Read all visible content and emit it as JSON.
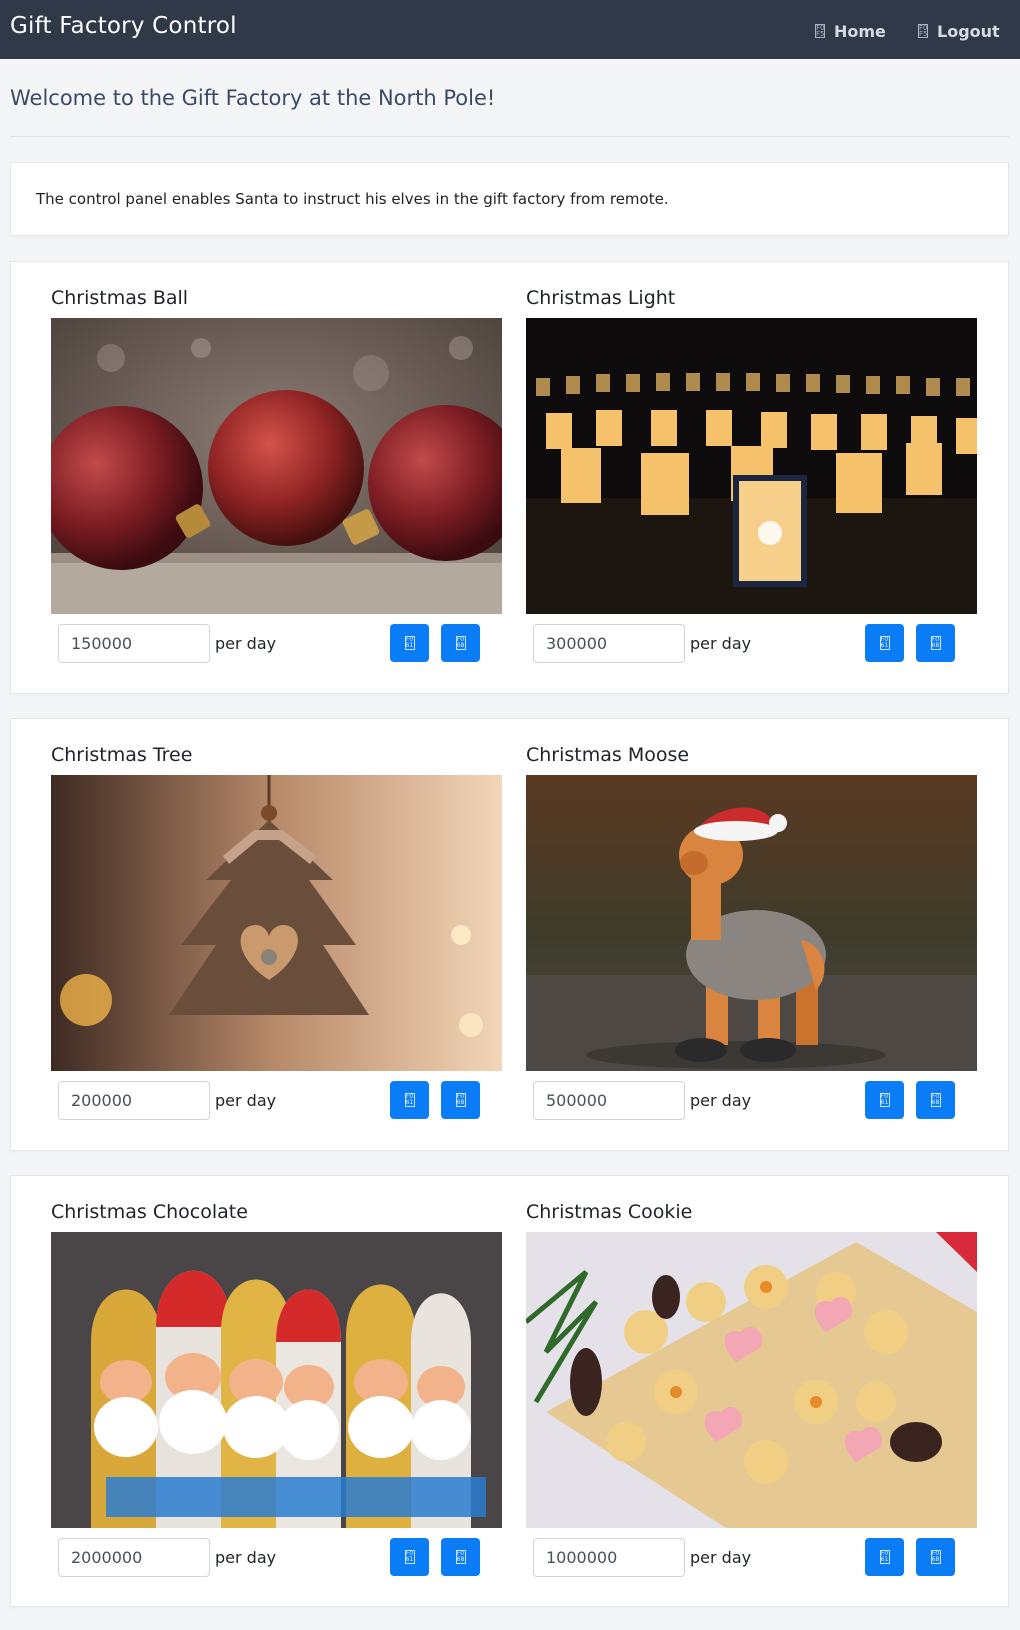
{
  "app": {
    "brand": "Gift Factory Control",
    "nav": {
      "home_label": "Home",
      "logout_label": "Logout",
      "home_icon_glyph": "F0\nF5",
      "logout_icon_glyph": "F0\nF5"
    }
  },
  "page": {
    "welcome": "Welcome to the Gift Factory at the North Pole!",
    "intro": "The control panel enables Santa to instruct his elves in the gift factory from remote."
  },
  "products": [
    {
      "name": "Christmas Ball",
      "quantity": "150000",
      "unit_label": "per day",
      "up_glyph": "F0\n61",
      "down_glyph": "F0\n68"
    },
    {
      "name": "Christmas Light",
      "quantity": "300000",
      "unit_label": "per day",
      "up_glyph": "F0\n61",
      "down_glyph": "F0\n68"
    },
    {
      "name": "Christmas Tree",
      "quantity": "200000",
      "unit_label": "per day",
      "up_glyph": "F0\n61",
      "down_glyph": "F0\n68"
    },
    {
      "name": "Christmas Moose",
      "quantity": "500000",
      "unit_label": "per day",
      "up_glyph": "F0\n61",
      "down_glyph": "F0\n68"
    },
    {
      "name": "Christmas Chocolate",
      "quantity": "2000000",
      "unit_label": "per day",
      "up_glyph": "F0\n61",
      "down_glyph": "F0\n68"
    },
    {
      "name": "Christmas Cookie",
      "quantity": "1000000",
      "unit_label": "per day",
      "up_glyph": "F0\n61",
      "down_glyph": "F0\n68"
    }
  ],
  "colors": {
    "navbar": "#2f3947",
    "button": "#0a7cf5",
    "page_bg": "#f4f5f7"
  },
  "icons": {
    "nav": "missing-glyph-icon",
    "increase": "missing-glyph-icon",
    "decrease": "missing-glyph-icon"
  }
}
